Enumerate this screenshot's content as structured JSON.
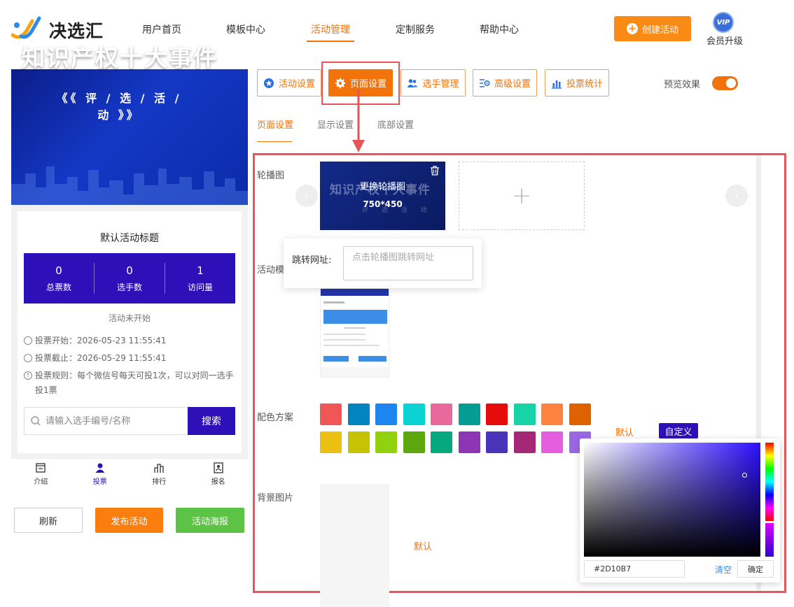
{
  "brand": {
    "name": "决选汇"
  },
  "nav": {
    "items": [
      "用户首页",
      "模板中心",
      "活动管理",
      "定制服务",
      "帮助中心"
    ],
    "active_index": 2
  },
  "header": {
    "create_label": "创建活动",
    "vip_badge": "VIP",
    "vip_label": "会员升级"
  },
  "preview": {
    "banner_title": "知识产权十大事件",
    "banner_subtitle": "《《 评 / 选 / 活 / 动 》》",
    "activity_title": "默认活动标题",
    "stats": [
      {
        "value": "0",
        "label": "总票数"
      },
      {
        "value": "0",
        "label": "选手数"
      },
      {
        "value": "1",
        "label": "访问量"
      }
    ],
    "status": "活动未开始",
    "vote_start": "投票开始：2026-05-23 11:55:41",
    "vote_end": "投票截止：2026-05-29 11:55:41",
    "vote_rule": "投票规则：每个微信号每天可投1次，可以对同一选手投1票",
    "search_placeholder": "请输入选手编号/名称",
    "search_button": "搜索",
    "tabs": [
      "介绍",
      "投票",
      "排行",
      "报名"
    ],
    "active_tab": 1
  },
  "actions": {
    "refresh": "刷新",
    "publish": "发布活动",
    "poster": "活动海报"
  },
  "toolbar": {
    "buttons": [
      "活动设置",
      "页面设置",
      "选手管理",
      "高级设置",
      "投票统计"
    ],
    "selected_index": 1,
    "preview_label": "预览效果",
    "preview_enabled": true
  },
  "subtabs": {
    "items": [
      "页面设置",
      "显示设置",
      "底部设置"
    ],
    "active_index": 0
  },
  "settings": {
    "carousel_label": "轮播图",
    "carousel_replace": "更换轮播图",
    "carousel_size": "750*450",
    "carousel_ghost_title": "知识产权十大事件",
    "carousel_ghost_sub": "评 选 活 动",
    "add_symbol": "+",
    "link_label": "跳转网址:",
    "link_placeholder": "点击轮播图跳转网址",
    "template_label": "活动模",
    "color_label": "配色方案",
    "color_default": "默认",
    "color_custom": "自定义",
    "background_label": "背景图片",
    "background_default": "默认"
  },
  "swatches": [
    "#f05656",
    "#0085c0",
    "#1e86f0",
    "#0bd3d3",
    "#e8699b",
    "#049c94",
    "#e60c0c",
    "#18d3a6",
    "#fe8340",
    "#e06100",
    "#eac013",
    "#c5c303",
    "#92d10e",
    "#5ea80f",
    "#06a97e",
    "#8d36b4",
    "#4a35b8",
    "#a42875",
    "#e55ee0",
    "#9b68e4"
  ],
  "picker": {
    "hex": "#2D10B7",
    "clear": "清空",
    "confirm": "确定"
  },
  "colors": {
    "accent": "#f2720c",
    "theme": "#2d10b7",
    "highlight": "#e8545a",
    "poster": "#5dc346"
  }
}
